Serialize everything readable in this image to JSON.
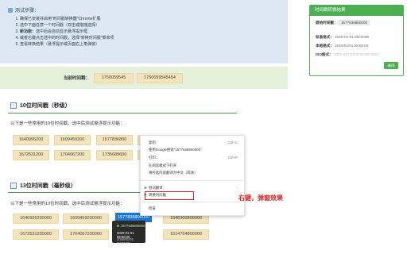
{
  "steps": {
    "title": "测试步骤：",
    "items": [
      "确保已安装并启用\"时间戳转换器\"Chrome扩展",
      "选中下面任意一个时间戳（双击或拖拽选择）",
      "选中后会自动显示悬浮提示框",
      "或者右键点击选中的时间戳，选择\"转换时间戳\"菜单项",
      "查看转换结果（悬浮提示或页面右上角弹窗）"
    ],
    "item3_bold": "新功能："
  },
  "now": {
    "label": "当前时间戳：",
    "values": [
      "1750059545",
      "1750059545454"
    ]
  },
  "sec10": {
    "title": "10位时间戳（秒级）",
    "desc": "以下是一些常用的10位时间戳，选中后测试悬浮提示功能：",
    "row1": [
      "1640995200",
      "1609459200",
      "1577836800",
      "154"
    ],
    "row2": [
      "1672531200",
      "1704067200",
      "1735689600",
      "176"
    ]
  },
  "sec13": {
    "title": "13位时间戳（毫秒级）",
    "desc": "以下是一些常用的13位时间戳，选中后测试悬浮提示功能：",
    "row1": [
      "1640995200000",
      "1609459200000",
      "1577836800000",
      "1546300800000"
    ],
    "row2": [
      "1672531200000",
      "1704067200000",
      "1514764800000"
    ]
  },
  "result": {
    "title": "时间戳转换结果",
    "original_label": "原始时间戳：",
    "original_value": "1577836800000",
    "std_label": "标准格式：",
    "std_value": "2020-01-01 08:00:00",
    "local_label": "本地格式：",
    "local_value": "2020/01/01 08:00:00",
    "iso_label": "ISO格式：",
    "iso_value": "2020-01-01T00:00:00.000Z",
    "close_label": "关闭"
  },
  "context_menu": {
    "items": [
      {
        "label": "复制",
        "shortcut": "Ctrl+C"
      },
      {
        "label": "使用Google搜索\"1577836800000\"",
        "shortcut": ""
      },
      {
        "label": "打印...",
        "shortcut": "Ctrl+P"
      },
      {
        "label": "在阅读模式下打开",
        "shortcut": ""
      },
      {
        "label": "将所选内容翻译为中文（简体）",
        "shortcut": ""
      },
      {
        "label": "划词翻译",
        "shortcut": ""
      },
      {
        "label": "转换时间戳",
        "shortcut": ""
      },
      {
        "label": "检查",
        "shortcut": ""
      }
    ]
  },
  "annotation": "右键，弹窗效果",
  "tooltip": {
    "value": "1577836800000",
    "line2": "2020-01-01 08:00:00",
    "line3": "2020/01/01 08:00:00"
  },
  "selected_text": "1577836800000"
}
